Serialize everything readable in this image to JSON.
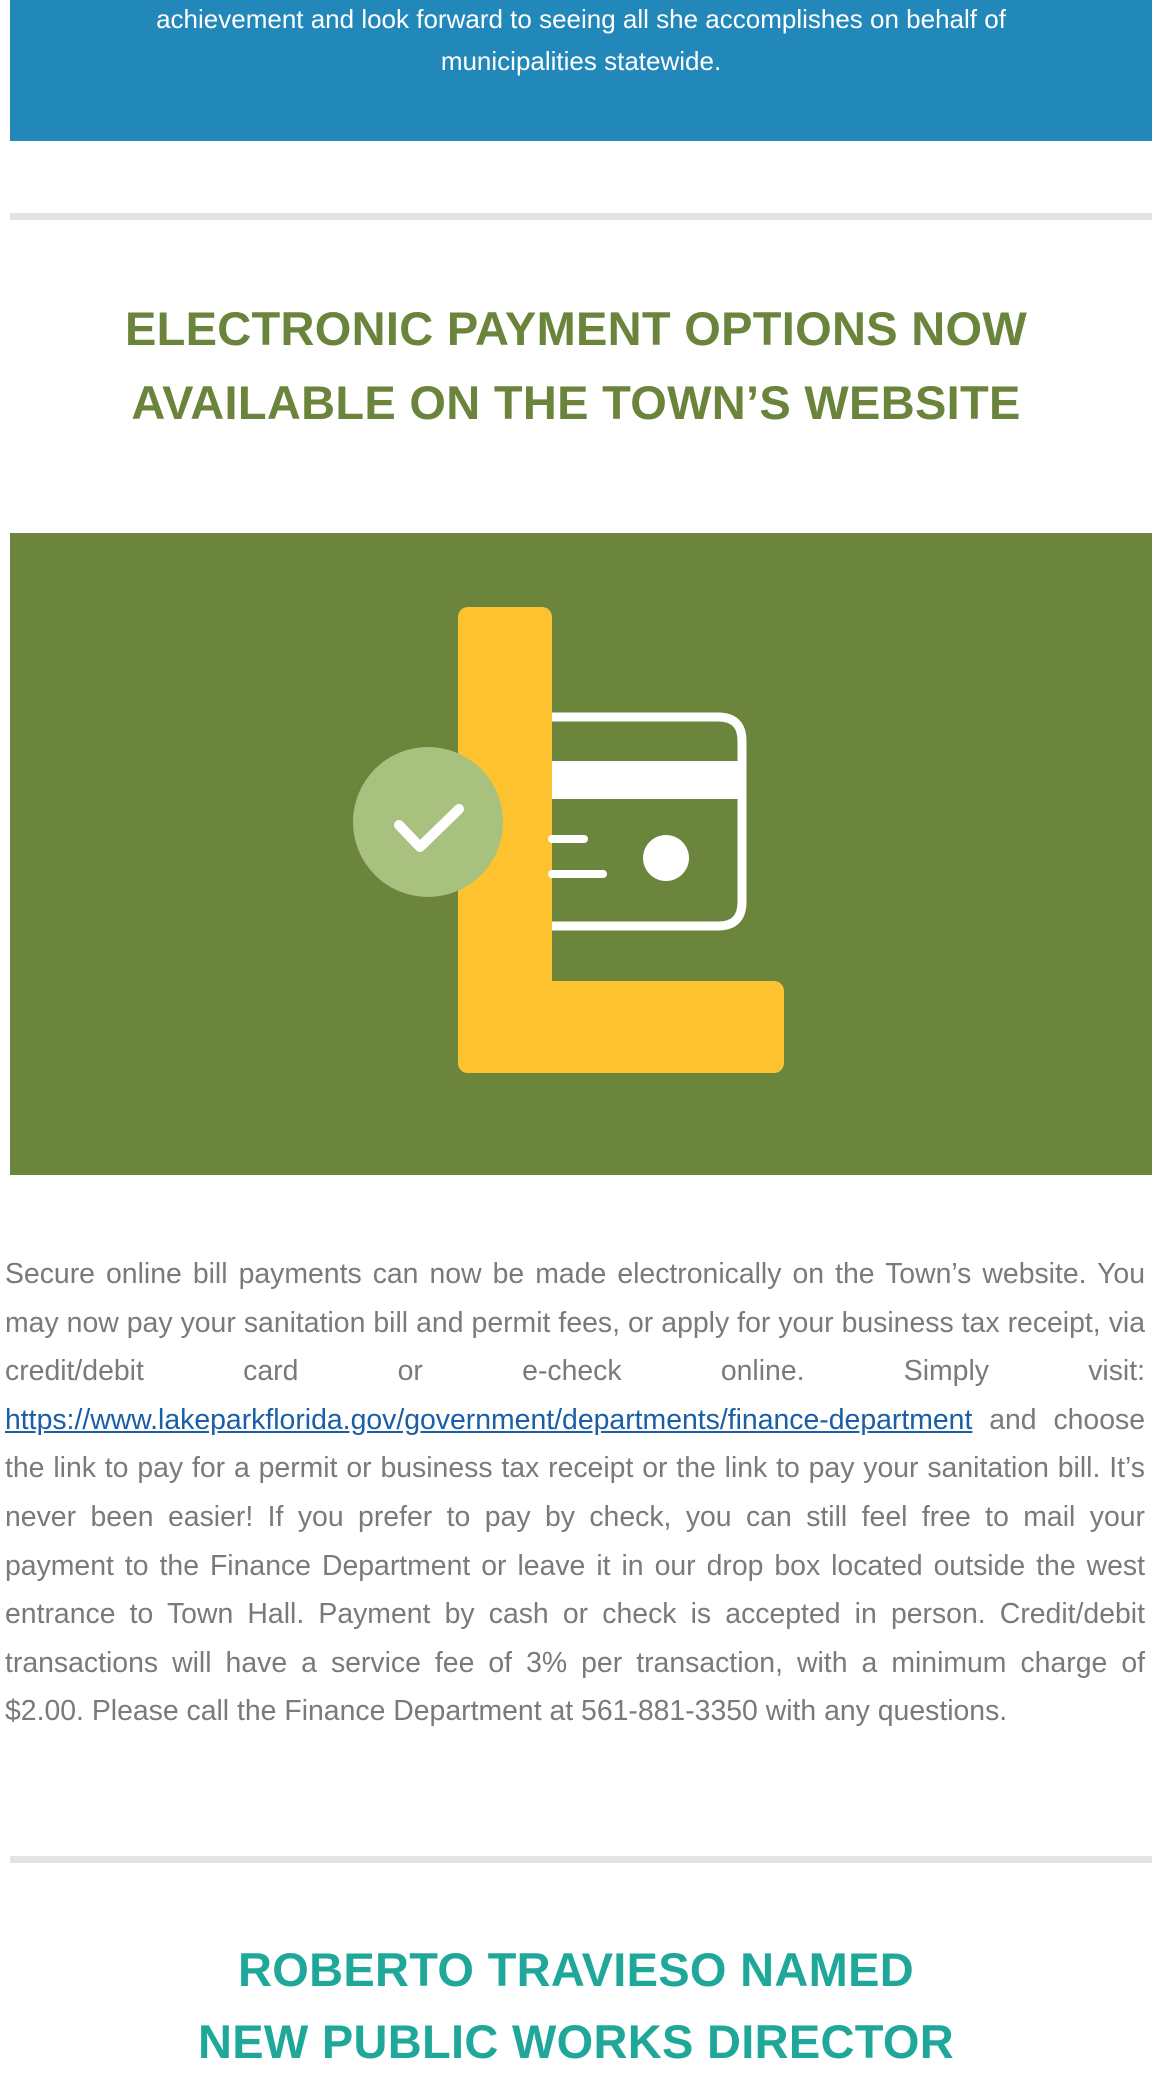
{
  "top_banner": {
    "text": "achievement and look forward to seeing all she accomplishes on behalf of municipalities statewide."
  },
  "article1": {
    "headline_line1": "ELECTRONIC PAYMENT OPTIONS NOW",
    "headline_line2": "AVAILABLE ON THE TOWN’S WEBSITE",
    "body_before_link": "Secure online bill payments can now be made electronically on the Town’s website. You may now pay your sanitation bill and permit fees, or apply for your business tax receipt, via credit/debit card or e-check online. Simply visit: ",
    "link_text": "https://www.lakeparkflorida.gov/government/departments/finance-department",
    "body_after_link": " and choose the link to pay for a permit or business tax receipt or the link to pay your sanitation bill. It’s never been easier! If you prefer to pay by check, you can still feel free to mail your payment to the Finance Department or leave it in our drop box located outside the west entrance to Town Hall. Payment by cash or check is accepted in person. Credit/debit transactions will have a service fee of 3% per transaction, with a minimum charge of $2.00. Please call the Finance Department at 561-881-3350 with any questions."
  },
  "article2": {
    "headline_line1": "ROBERTO TRAVIESO NAMED",
    "headline_line2": "NEW PUBLIC WORKS DIRECTOR"
  },
  "colors": {
    "banner_blue": "#2287b9",
    "headline_green": "#6b843c",
    "headline_teal": "#1fa89a",
    "hero_green": "#6c853d",
    "logo_yellow": "#fcc22f",
    "check_circle": "#a9c17f",
    "link_blue": "#1a5ea8"
  },
  "icons": {
    "hero": "online-payment-illustration",
    "check": "checkmark-icon",
    "card": "credit-card-icon",
    "logo": "letter-l-logo"
  }
}
